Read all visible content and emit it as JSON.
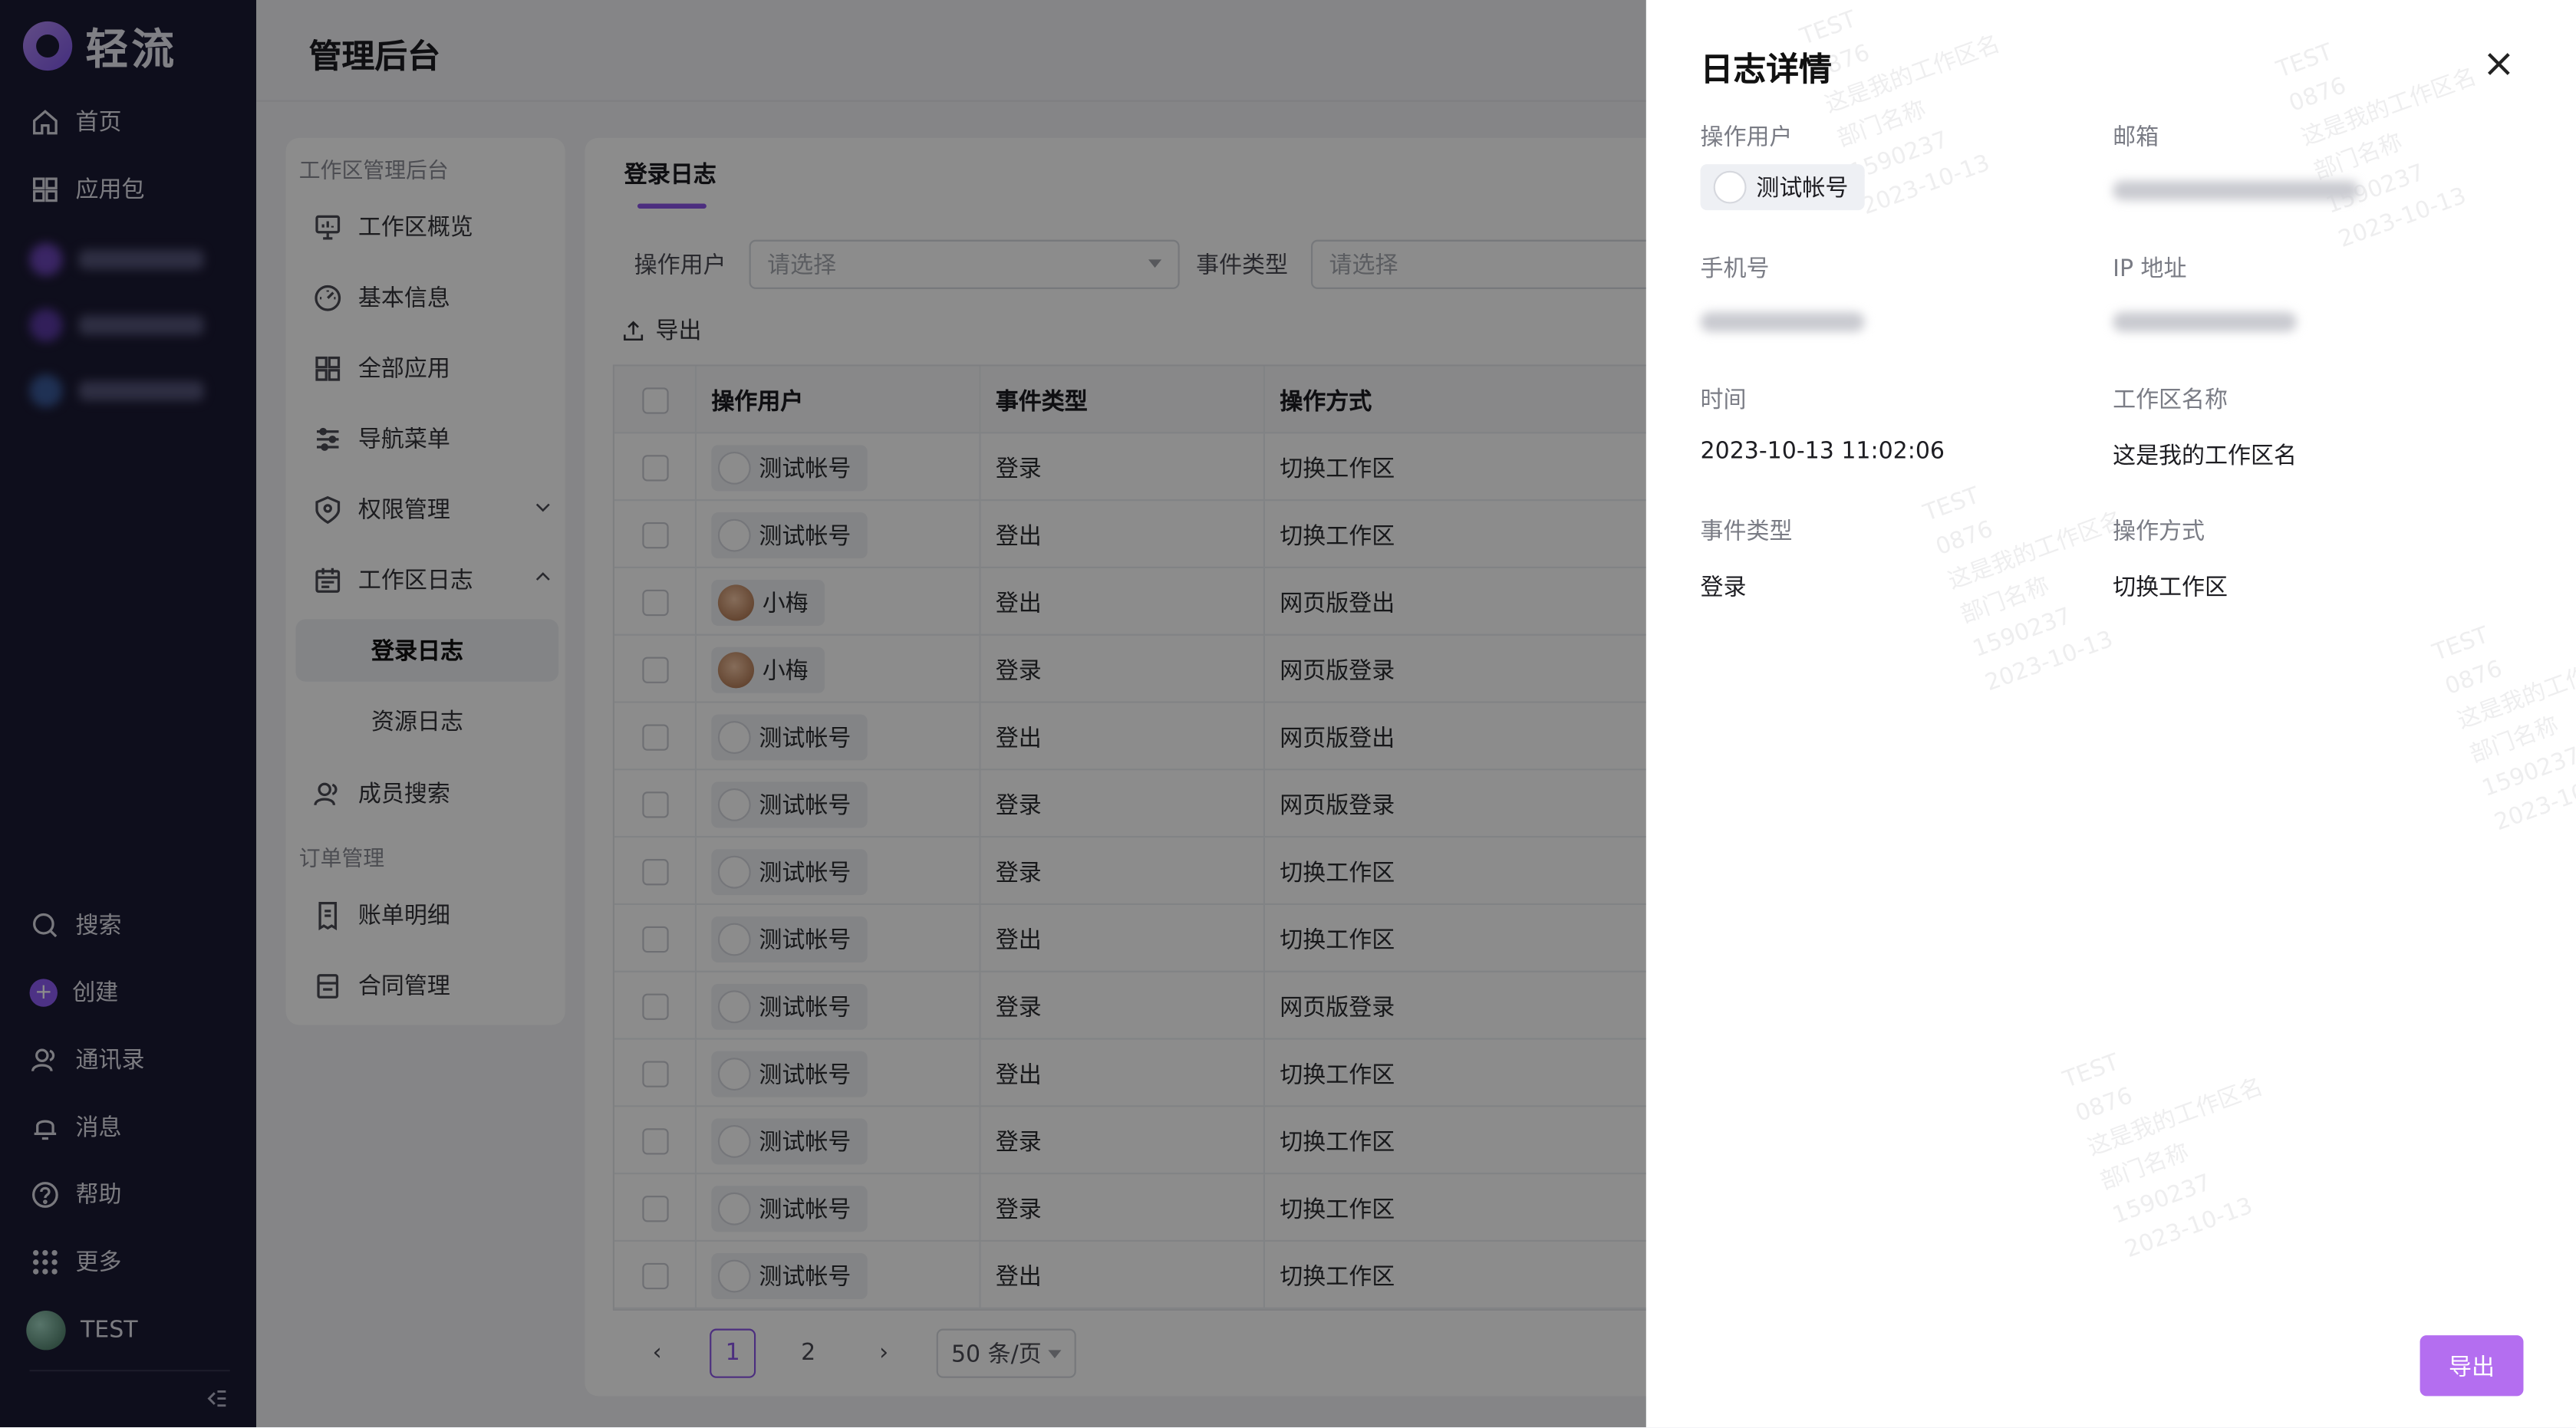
{
  "app": {
    "name": "轻流",
    "page_title": "管理后台"
  },
  "sidebar": {
    "items": [
      {
        "label": "首页",
        "icon": "home-icon"
      },
      {
        "label": "应用包",
        "icon": "grid-icon"
      }
    ],
    "bottom": [
      {
        "label": "搜索",
        "icon": "search-icon"
      },
      {
        "label": "创建",
        "icon": "plus-icon"
      },
      {
        "label": "通讯录",
        "icon": "contacts-icon"
      },
      {
        "label": "消息",
        "icon": "bell-icon"
      },
      {
        "label": "帮助",
        "icon": "help-icon"
      },
      {
        "label": "更多",
        "icon": "apps-icon"
      }
    ],
    "user": "TEST"
  },
  "subnav": {
    "group1": "工作区管理后台",
    "items": [
      {
        "label": "工作区概览",
        "icon": "monitor-icon"
      },
      {
        "label": "基本信息",
        "icon": "dashboard-icon"
      },
      {
        "label": "全部应用",
        "icon": "grid-icon"
      },
      {
        "label": "导航菜单",
        "icon": "sliders-icon"
      },
      {
        "label": "权限管理",
        "icon": "shield-icon"
      },
      {
        "label": "工作区日志",
        "icon": "calendar-icon"
      }
    ],
    "children": [
      "登录日志",
      "资源日志"
    ],
    "member": "成员搜索",
    "group2": "订单管理",
    "orders": [
      "账单明细",
      "合同管理"
    ]
  },
  "panel": {
    "tab": "登录日志",
    "filter_user_label": "操作用户",
    "filter_user_placeholder": "请选择",
    "filter_event_label": "事件类型",
    "filter_event_placeholder": "请选择",
    "export": "导出",
    "columns": [
      "操作用户",
      "事件类型",
      "操作方式"
    ],
    "rows": [
      {
        "user": "测试帐号",
        "event": "登录",
        "way": "切换工作区"
      },
      {
        "user": "测试帐号",
        "event": "登出",
        "way": "切换工作区"
      },
      {
        "user": "小梅",
        "event": "登出",
        "way": "网页版登出"
      },
      {
        "user": "小梅",
        "event": "登录",
        "way": "网页版登录"
      },
      {
        "user": "测试帐号",
        "event": "登出",
        "way": "网页版登出"
      },
      {
        "user": "测试帐号",
        "event": "登录",
        "way": "网页版登录"
      },
      {
        "user": "测试帐号",
        "event": "登录",
        "way": "切换工作区"
      },
      {
        "user": "测试帐号",
        "event": "登出",
        "way": "切换工作区"
      },
      {
        "user": "测试帐号",
        "event": "登录",
        "way": "网页版登录"
      },
      {
        "user": "测试帐号",
        "event": "登出",
        "way": "切换工作区"
      },
      {
        "user": "测试帐号",
        "event": "登录",
        "way": "切换工作区"
      },
      {
        "user": "测试帐号",
        "event": "登录",
        "way": "切换工作区"
      },
      {
        "user": "测试帐号",
        "event": "登出",
        "way": "切换工作区"
      }
    ],
    "pager": {
      "prev": "‹",
      "pages": [
        "1",
        "2"
      ],
      "current": "1",
      "next": "›",
      "size": "50 条/页"
    }
  },
  "drawer": {
    "title": "日志详情",
    "fields": {
      "user_label": "操作用户",
      "user_value": "测试帐号",
      "email_label": "邮箱",
      "phone_label": "手机号",
      "ip_label": "IP 地址",
      "time_label": "时间",
      "time_value": "2023-10-13 11:02:06",
      "ws_label": "工作区名称",
      "ws_value": "这是我的工作区名",
      "event_label": "事件类型",
      "event_value": "登录",
      "way_label": "操作方式",
      "way_value": "切换工作区"
    },
    "export": "导出"
  },
  "watermark": "TEST\n0876\n这是我的工作区名\n部门名称\n1590237\n2023-10-13",
  "colors": {
    "sidebar": "#1b1a33",
    "accent": "#8a55e8",
    "export_button": "#b46ef0"
  }
}
